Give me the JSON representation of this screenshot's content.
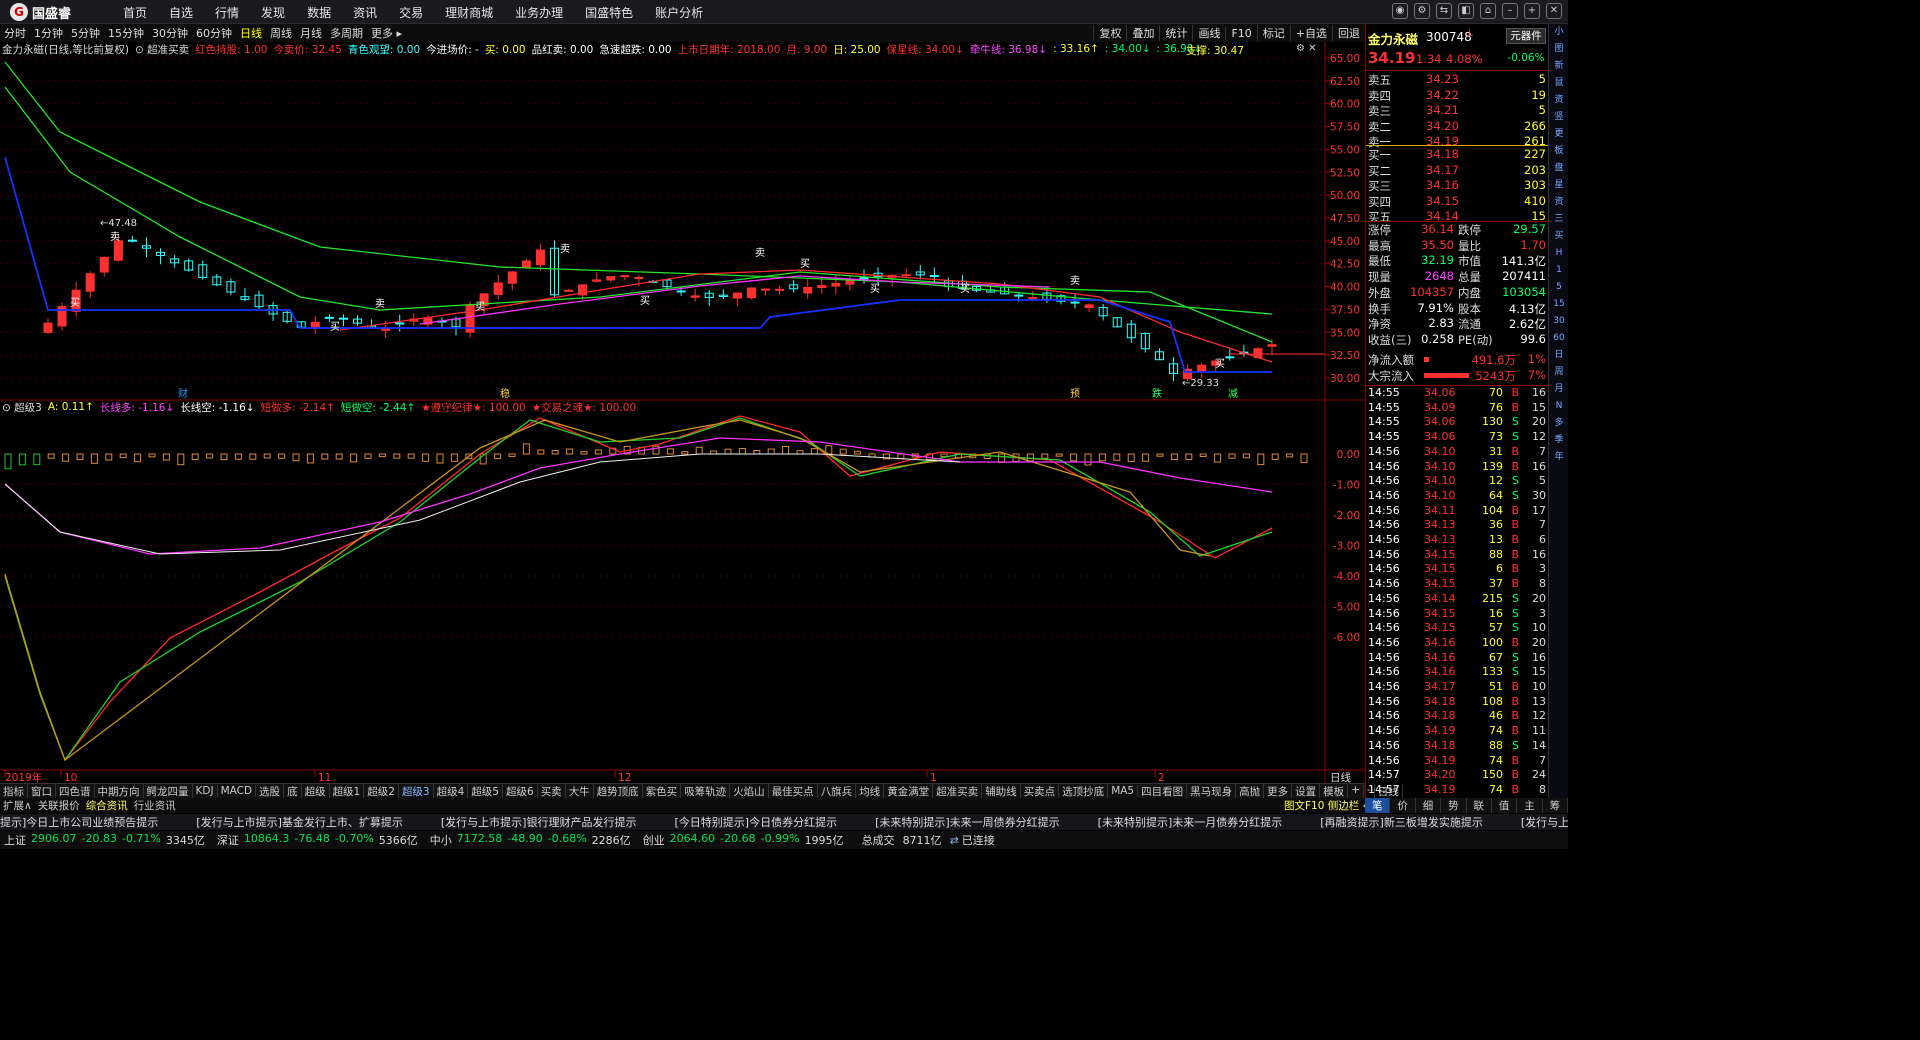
{
  "app": {
    "brand": "国盛睿",
    "menu": [
      "首页",
      "自选",
      "行情",
      "发现",
      "数据",
      "资讯",
      "交易",
      "理财商城",
      "业务办理",
      "国盛特色",
      "账户分析"
    ]
  },
  "window_controls": [
    "消息",
    "设置",
    "切换",
    "皮肤",
    "工具",
    "最小化",
    "最大化",
    "关闭"
  ],
  "periods": [
    "分时",
    "1分钟",
    "5分钟",
    "15分钟",
    "30分钟",
    "60分钟",
    "日线",
    "周线",
    "月线",
    "多周期",
    "更多 ▸"
  ],
  "active_period": "日线",
  "toolbar_right": [
    "复权",
    "叠加",
    "统计",
    "画线",
    "F10",
    "标记",
    "+自选",
    "回退"
  ],
  "info_main": [
    {
      "t": "金力永磁(日线,等比前复权)",
      "c": "#dddddd"
    },
    {
      "t": "⊙ 超准买卖",
      "c": "#dddddd"
    },
    {
      "t": "红色持股: 1.00",
      "c": "#ff3030"
    },
    {
      "t": "今卖价: 32.45",
      "c": "#ff3030"
    },
    {
      "t": "青色观望: 0.00",
      "c": "#33ffff"
    },
    {
      "t": "今进场价: -",
      "c": "#ffffff"
    },
    {
      "t": "买: 0.00",
      "c": "#ffff33"
    },
    {
      "t": "品红卖: 0.00",
      "c": "#ffffff"
    },
    {
      "t": "急速超跌: 0.00",
      "c": "#ffffff"
    },
    {
      "t": "上市日期年: 2018.00",
      "c": "#ff3030"
    },
    {
      "t": "月: 9.00",
      "c": "#ff3030"
    },
    {
      "t": "日: 25.00",
      "c": "#ffff33"
    },
    {
      "t": "保星线: 34.00↓",
      "c": "#ff3030"
    },
    {
      "t": "牵牛线: 36.98↓",
      "c": "#ff44ff"
    },
    {
      "t": ": 33.16↑",
      "c": "#ffff33"
    },
    {
      "t": ": 34.00↓",
      "c": "#00ff66"
    },
    {
      "t": ": 36.98↓",
      "c": "#00ff66"
    }
  ],
  "support_label": "支撑: 30.47",
  "info_sub": [
    {
      "t": "⊙ 超级3",
      "c": "#dddddd"
    },
    {
      "t": "A: 0.11↑",
      "c": "#ffff33"
    },
    {
      "t": "长线多: -1.16↓",
      "c": "#ff44ff"
    },
    {
      "t": "长线空: -1.16↓",
      "c": "#ffffff"
    },
    {
      "t": "短做多: -2.14↑",
      "c": "#ff3030"
    },
    {
      "t": "短做空: -2.44↑",
      "c": "#00ff66"
    },
    {
      "t": "★遵守纪律★: 100.00",
      "c": "#ff3030"
    },
    {
      "t": "★交易之魂★: 100.00",
      "c": "#ff3030"
    }
  ],
  "price_axis": [
    "65.00",
    "62.50",
    "60.00",
    "57.50",
    "55.00",
    "52.50",
    "50.00",
    "47.50",
    "45.00",
    "42.50",
    "40.00",
    "37.50",
    "35.00",
    "32.50",
    "30.00"
  ],
  "osc_axis": [
    "0.00",
    "-1.00",
    "-2.00",
    "-3.00",
    "-4.00",
    "-5.00",
    "-6.00"
  ],
  "date_axis": [
    "2019年",
    "10",
    "11",
    "12",
    "1",
    "2"
  ],
  "axis_mode": "日线",
  "price_labels": {
    "high": "47.48",
    "low": "29.33"
  },
  "signal_words": {
    "buy": "买",
    "sell": "卖"
  },
  "event_marks": [
    {
      "t": "财",
      "c": "#2196f3"
    },
    {
      "t": "稳",
      "c": "#ffd24d"
    },
    {
      "t": "预",
      "c": "#ffd24d"
    },
    {
      "t": "跌",
      "c": "#33ff66"
    },
    {
      "t": "减",
      "c": "#33ff66"
    }
  ],
  "stock": {
    "name": "金力永磁",
    "code": "300748",
    "flag": "L",
    "price": "34.19",
    "change": "1.34",
    "pct": "4.08%",
    "tool": "元器件",
    "tool_pct": "-0.06%"
  },
  "orderbook": {
    "asks": [
      {
        "l": "卖五",
        "p": "34.23",
        "v": "5"
      },
      {
        "l": "卖四",
        "p": "34.22",
        "v": "19"
      },
      {
        "l": "卖三",
        "p": "34.21",
        "v": "5"
      },
      {
        "l": "卖二",
        "p": "34.20",
        "v": "266"
      },
      {
        "l": "卖一",
        "p": "34.19",
        "v": "261"
      }
    ],
    "bids": [
      {
        "l": "买一",
        "p": "34.18",
        "v": "227"
      },
      {
        "l": "买二",
        "p": "34.17",
        "v": "203"
      },
      {
        "l": "买三",
        "p": "34.16",
        "v": "303"
      },
      {
        "l": "买四",
        "p": "34.15",
        "v": "410"
      },
      {
        "l": "买五",
        "p": "34.14",
        "v": "15"
      }
    ]
  },
  "stats": [
    {
      "a": "涨停",
      "av": "36.14",
      "ac": "#ff3030",
      "b": "跌停",
      "bv": "29.57",
      "bc": "#00ff66"
    },
    {
      "a": "最高",
      "av": "35.50",
      "ac": "#ff3030",
      "b": "量比",
      "bv": "1.70",
      "bc": "#ff3030"
    },
    {
      "a": "最低",
      "av": "32.19",
      "ac": "#00ff66",
      "b": "市值",
      "bv": "141.3亿",
      "bc": "#ffffff"
    },
    {
      "a": "现量",
      "av": "2648",
      "ac": "#ff44ff",
      "b": "总量",
      "bv": "207411",
      "bc": "#ffffff"
    },
    {
      "a": "外盘",
      "av": "104357",
      "ac": "#ff3030",
      "b": "内盘",
      "bv": "103054",
      "bc": "#00ff66"
    },
    {
      "a": "换手",
      "av": "7.91%",
      "ac": "#ffffff",
      "b": "股本",
      "bv": "4.13亿",
      "bc": "#ffffff"
    },
    {
      "a": "净资",
      "av": "2.83",
      "ac": "#ffffff",
      "b": "流通",
      "bv": "2.62亿",
      "bc": "#ffffff"
    },
    {
      "a": "收益(三)",
      "av": "0.258",
      "ac": "#ffffff",
      "b": "PE(动)",
      "bv": "99.6",
      "bc": "#ffffff"
    }
  ],
  "flows": [
    {
      "l": "净流入额",
      "v": "491.6万",
      "p": "1%",
      "bar": 0.07
    },
    {
      "l": "大宗流入",
      "v": "5243万",
      "p": "7%",
      "bar": 0.6
    }
  ],
  "ticks": [
    {
      "t": "14:55",
      "p": "34.06",
      "v": "70",
      "d": "B",
      "n": "16"
    },
    {
      "t": "14:55",
      "p": "34.09",
      "v": "76",
      "d": "B",
      "n": "15"
    },
    {
      "t": "14:55",
      "p": "34.06",
      "v": "130",
      "d": "S",
      "n": "20"
    },
    {
      "t": "14:55",
      "p": "34.06",
      "v": "73",
      "d": "S",
      "n": "12"
    },
    {
      "t": "14:56",
      "p": "34.10",
      "v": "31",
      "d": "B",
      "n": "7"
    },
    {
      "t": "14:56",
      "p": "34.10",
      "v": "139",
      "d": "B",
      "n": "16"
    },
    {
      "t": "14:56",
      "p": "34.10",
      "v": "12",
      "d": "S",
      "n": "5"
    },
    {
      "t": "14:56",
      "p": "34.10",
      "v": "64",
      "d": "S",
      "n": "30"
    },
    {
      "t": "14:56",
      "p": "34.11",
      "v": "104",
      "d": "B",
      "n": "17"
    },
    {
      "t": "14:56",
      "p": "34.13",
      "v": "36",
      "d": "B",
      "n": "7"
    },
    {
      "t": "14:56",
      "p": "34.13",
      "v": "13",
      "d": "B",
      "n": "6"
    },
    {
      "t": "14:56",
      "p": "34.15",
      "v": "88",
      "d": "B",
      "n": "16"
    },
    {
      "t": "14:56",
      "p": "34.15",
      "v": "6",
      "d": "B",
      "n": "3"
    },
    {
      "t": "14:56",
      "p": "34.15",
      "v": "37",
      "d": "B",
      "n": "8"
    },
    {
      "t": "14:56",
      "p": "34.14",
      "v": "215",
      "d": "S",
      "n": "20"
    },
    {
      "t": "14:56",
      "p": "34.15",
      "v": "16",
      "d": "S",
      "n": "3"
    },
    {
      "t": "14:56",
      "p": "34.15",
      "v": "57",
      "d": "S",
      "n": "10"
    },
    {
      "t": "14:56",
      "p": "34.16",
      "v": "100",
      "d": "B",
      "n": "20"
    },
    {
      "t": "14:56",
      "p": "34.16",
      "v": "67",
      "d": "S",
      "n": "16"
    },
    {
      "t": "14:56",
      "p": "34.16",
      "v": "133",
      "d": "S",
      "n": "15"
    },
    {
      "t": "14:56",
      "p": "34.17",
      "v": "51",
      "d": "B",
      "n": "10"
    },
    {
      "t": "14:56",
      "p": "34.18",
      "v": "108",
      "d": "B",
      "n": "13"
    },
    {
      "t": "14:56",
      "p": "34.18",
      "v": "46",
      "d": "B",
      "n": "12"
    },
    {
      "t": "14:56",
      "p": "34.19",
      "v": "74",
      "d": "B",
      "n": "11"
    },
    {
      "t": "14:56",
      "p": "34.18",
      "v": "88",
      "d": "S",
      "n": "14"
    },
    {
      "t": "14:56",
      "p": "34.19",
      "v": "74",
      "d": "B",
      "n": "7"
    },
    {
      "t": "14:57",
      "p": "34.20",
      "v": "150",
      "d": "B",
      "n": "24"
    },
    {
      "t": "14:57",
      "p": "34.19",
      "v": "74",
      "d": "B",
      "n": "8"
    },
    {
      "t": "15:00",
      "p": "34.19",
      "v": "2648",
      "d": "B",
      "n": "528"
    }
  ],
  "side_icons": [
    "小",
    "图",
    "新",
    "鼠",
    "资",
    "竖",
    "更",
    "板",
    "盘",
    "星",
    "资",
    "三",
    "买",
    "H",
    "1",
    "5",
    "15",
    "30",
    "60",
    "日",
    "周",
    "月",
    "N",
    "多",
    "季",
    "年"
  ],
  "tabs1": [
    "指标",
    "窗口",
    "四色谱",
    "中期方向",
    "鳄龙四量",
    "KDJ",
    "MACD",
    "选股",
    "底",
    "超级",
    "超级1",
    "超级2",
    "超级3",
    "超级4",
    "超级5",
    "超级6",
    "买卖",
    "大牛",
    "趋势顶底",
    "紫色买",
    "吸筹轨迹",
    "火焰山",
    "最佳买点",
    "八旗兵",
    "均线",
    "黄金满堂",
    "超准买卖",
    "辅助线",
    "买卖点",
    "选顶抄底",
    "MA5",
    "四目看图",
    "黑马现身",
    "高抛",
    "更多",
    "设置"
  ],
  "tabs1_active": "超级3",
  "tabs1_right": [
    "模板",
    "+",
    "-",
    "日线"
  ],
  "tabs2": [
    "扩展∧",
    "关联报价",
    "综合资讯",
    "行业资讯"
  ],
  "tabs2_active": "综合资讯",
  "tabs2_right": "图文F10 侧边栏 «",
  "right_tabs": [
    "笔",
    "价",
    "细",
    "势",
    "联",
    "值",
    "主",
    "筹"
  ],
  "right_tabs_active": "笔",
  "ticker": [
    "提示]今日上市公司业绩预告提示",
    "[发行与上市提示]基金发行上市、扩募提示",
    "[发行与上市提示]银行理财产品发行提示",
    "[今日特别提示]今日债券分红提示",
    "[未来特别提示]未来一周债券分红提示",
    "[未来特别提示]未来一月债券分红提示",
    "[再融资提示]新三板增发实施提示",
    "[发行与上市提示]债券发行与上市提示"
  ],
  "status": {
    "sh": {
      "n": "上证",
      "v": "2906.07",
      "c": "-20.83",
      "p": "-0.71%",
      "a": "3345亿"
    },
    "sz": {
      "n": "深证",
      "v": "10864.3",
      "c": "-76.48",
      "p": "-0.70%",
      "a": "5366亿"
    },
    "zx": {
      "n": "中小",
      "v": "7172.58",
      "c": "-48.90",
      "p": "-0.68%",
      "a": "2286亿"
    },
    "cy": {
      "n": "创业",
      "v": "2064.60",
      "c": "-20.68",
      "p": "-0.99%",
      "a": "1995亿"
    },
    "total_label": "总成交",
    "total": "8711亿",
    "conn": "已连接"
  },
  "colors": {
    "up": "#ff3030",
    "down": "#33ffff",
    "ma_green": "#22e62a",
    "ma_red": "#ff2a2a",
    "ma_magenta": "#ff33ff",
    "support": "#1530ff",
    "accent": "#1d4e9e"
  }
}
